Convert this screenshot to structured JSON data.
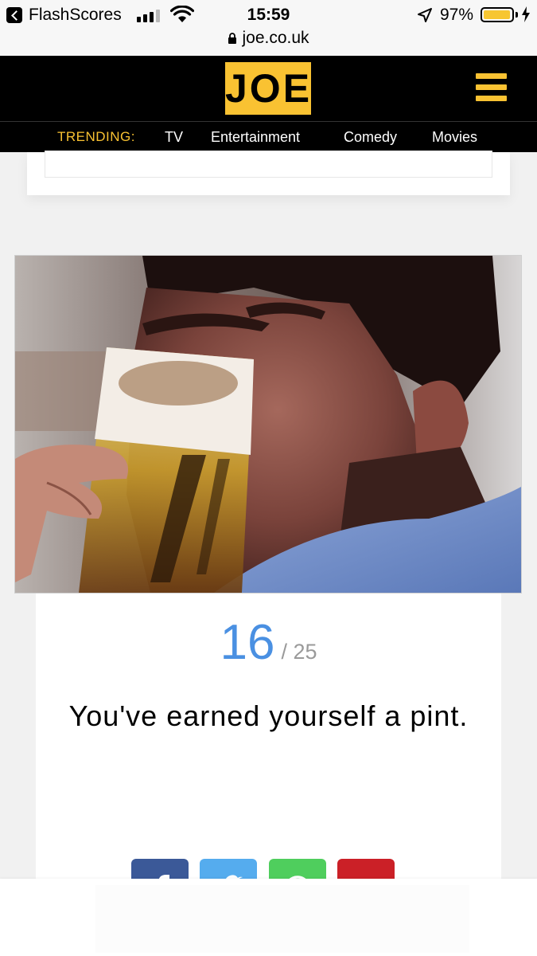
{
  "status_bar": {
    "back_app": "FlashScores",
    "time": "15:59",
    "battery_percent": "97%",
    "battery_level": 0.97,
    "battery_color": "#f7c631"
  },
  "browser": {
    "url": "joe.co.uk"
  },
  "header": {
    "logo": "JOE",
    "brand_color": "#f9c232",
    "menu_icon": "hamburger-menu-icon"
  },
  "trending": {
    "label": "TRENDING:",
    "links": [
      "TV",
      "Entertainment",
      "Comedy",
      "Movies"
    ]
  },
  "quiz_result": {
    "score": "16",
    "total": "/ 25",
    "message": "You've earned yourself a pint.",
    "score_color": "#4a90e2"
  },
  "share_buttons": [
    {
      "network": "facebook",
      "icon": "facebook-icon",
      "color": "#3b5998"
    },
    {
      "network": "twitter",
      "icon": "twitter-icon",
      "color": "#55acee"
    },
    {
      "network": "whatsapp",
      "icon": "whatsapp-icon",
      "color": "#4fce5d"
    },
    {
      "network": "pinterest",
      "icon": "pinterest-icon",
      "color": "#cb2027"
    }
  ]
}
